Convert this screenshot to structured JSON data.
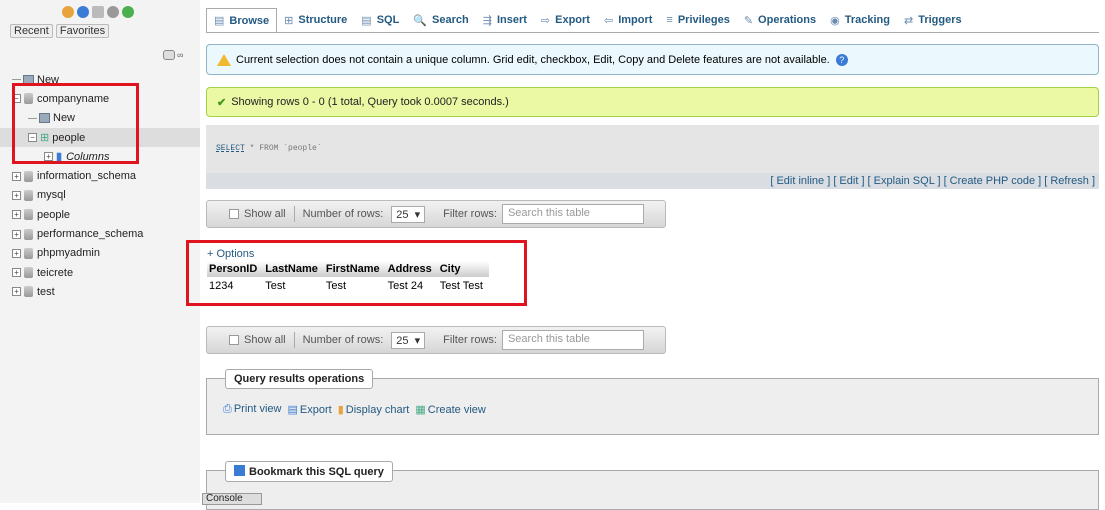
{
  "sidebar": {
    "recent_label": "Recent",
    "favorites_label": "Favorites",
    "tree": [
      {
        "label": "New",
        "kind": "new",
        "indent": 0
      },
      {
        "label": "companyname",
        "kind": "db",
        "indent": 0
      },
      {
        "label": "New",
        "kind": "new",
        "indent": 1
      },
      {
        "label": "people",
        "kind": "table",
        "indent": 1
      },
      {
        "label": "Columns",
        "kind": "columns",
        "indent": 2
      },
      {
        "label": "information_schema",
        "kind": "db",
        "indent": 0
      },
      {
        "label": "mysql",
        "kind": "db",
        "indent": 0
      },
      {
        "label": "people",
        "kind": "db",
        "indent": 0
      },
      {
        "label": "performance_schema",
        "kind": "db",
        "indent": 0
      },
      {
        "label": "phpmyadmin",
        "kind": "db",
        "indent": 0
      },
      {
        "label": "teicrete",
        "kind": "db",
        "indent": 0
      },
      {
        "label": "test",
        "kind": "db",
        "indent": 0
      }
    ]
  },
  "tabs": [
    "Browse",
    "Structure",
    "SQL",
    "Search",
    "Insert",
    "Export",
    "Import",
    "Privileges",
    "Operations",
    "Tracking",
    "Triggers"
  ],
  "notice": "Current selection does not contain a unique column. Grid edit, checkbox, Edit, Copy and Delete features are not available.",
  "success": "Showing rows 0 - 0 (1 total, Query took 0.0007 seconds.)",
  "sql": {
    "keyword": "SELECT",
    "rest": " * FROM `people`"
  },
  "sql_links": "[ Edit inline ] [ Edit ] [ Explain SQL ] [ Create PHP code ] [ Refresh ]",
  "nav": {
    "show_all": "Show all",
    "rows_label": "Number of rows:",
    "rows_value": "25",
    "filter_label": "Filter rows:",
    "filter_placeholder": "Search this table"
  },
  "options_link": "+ Options",
  "table": {
    "headers": [
      "PersonID",
      "LastName",
      "FirstName",
      "Address",
      "City"
    ],
    "rows": [
      [
        "1234",
        "Test",
        "Test",
        "Test 24",
        "Test Test"
      ]
    ]
  },
  "qro": {
    "legend": "Query results operations",
    "links": [
      "Print view",
      "Export",
      "Display chart",
      "Create view"
    ]
  },
  "bookmark": "Bookmark this SQL query",
  "console": "Console"
}
